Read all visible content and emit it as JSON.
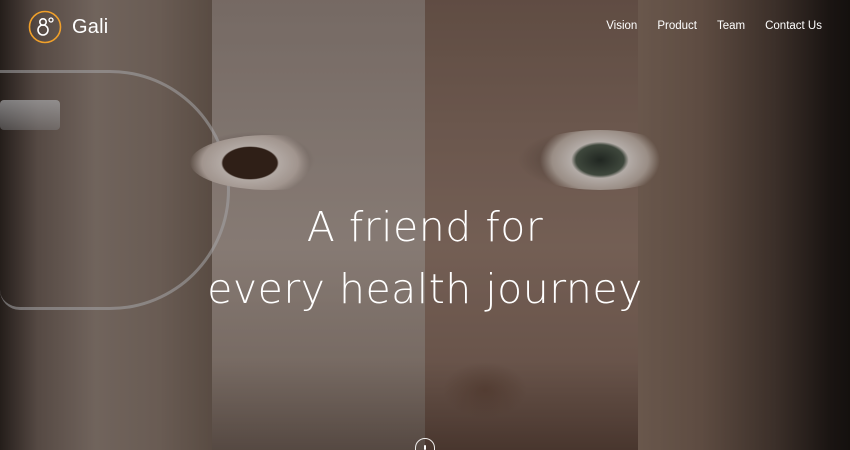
{
  "brand": {
    "name": "Gali",
    "logo_icon": "gali-logo-icon",
    "accent_color": "#f0a02a"
  },
  "nav": {
    "items": [
      {
        "label": "Vision"
      },
      {
        "label": "Product"
      },
      {
        "label": "Team"
      },
      {
        "label": "Contact Us"
      }
    ]
  },
  "hero": {
    "headline_line1": "A friend for",
    "headline_line2": "every health journey",
    "background_image": "composite-face-strips",
    "scroll_icon": "mouse-scroll-icon"
  }
}
